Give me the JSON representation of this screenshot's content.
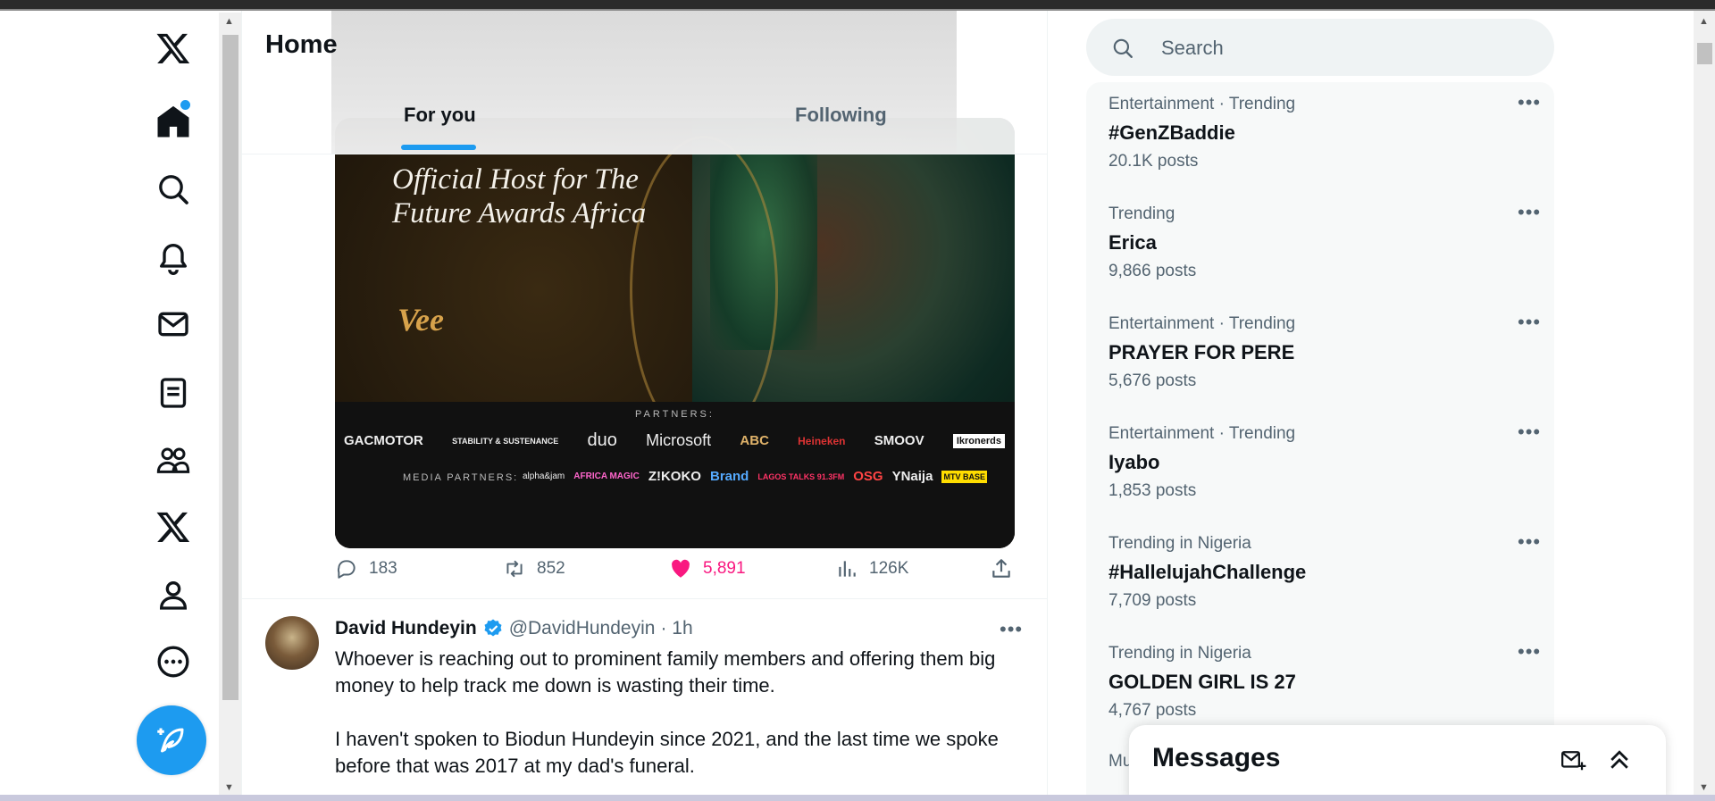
{
  "nav": {
    "items": [
      {
        "icon": "x-logo-icon"
      },
      {
        "icon": "home-icon",
        "has_notification_dot": true
      },
      {
        "icon": "search-icon"
      },
      {
        "icon": "bell-icon"
      },
      {
        "icon": "mail-icon"
      },
      {
        "icon": "lists-icon"
      },
      {
        "icon": "communities-icon"
      },
      {
        "icon": "premium-x-icon"
      },
      {
        "icon": "profile-icon"
      },
      {
        "icon": "more-circle-icon"
      }
    ],
    "compose_icon": "compose-feather-icon"
  },
  "header": {
    "title": "Home",
    "tabs": [
      {
        "label": "For you",
        "active": true
      },
      {
        "label": "Following",
        "active": false
      }
    ]
  },
  "media_card": {
    "host_text": "Official Host for The Future Awards Africa",
    "name_text": "Vee",
    "partners_label": "PARTNERS:",
    "media_partners_label": "MEDIA PARTNERS:",
    "partner_logos": [
      "GACMOTOR",
      "STABILITY & SUSTENANCE",
      "duo",
      "Microsoft",
      "ABC",
      "Heineken",
      "SMOOV",
      "Ikronerds"
    ],
    "media_partner_logos": [
      "alpha&jam",
      "AFRICA MAGIC",
      "Z!KOKO",
      "Brand",
      "LAGOS TALKS 91.3FM",
      "OSG",
      "YNaija",
      "MTV BASE"
    ]
  },
  "tweet1_actions": {
    "replies": "183",
    "retweets": "852",
    "likes": "5,891",
    "views": "126K"
  },
  "tweet2": {
    "name": "David Hundeyin",
    "handle": "@DavidHundeyin",
    "time": "· 1h",
    "more": "•••",
    "text_p1": "Whoever is reaching out to prominent family members and offering them big money to help track me down is wasting their time.",
    "text_p2": "I haven't spoken to Biodun Hundeyin since 2021, and the last time we spoke before that was 2017 at my dad's funeral."
  },
  "search": {
    "placeholder": "Search"
  },
  "trends": [
    {
      "category": "Entertainment · Trending",
      "title": "#GenZBaddie",
      "posts": "20.1K posts"
    },
    {
      "category": "Trending",
      "title": "Erica",
      "posts": "9,866 posts"
    },
    {
      "category": "Entertainment · Trending",
      "title": "PRAYER FOR PERE",
      "posts": "5,676 posts"
    },
    {
      "category": "Entertainment · Trending",
      "title": "Iyabo",
      "posts": "1,853 posts"
    },
    {
      "category": "Trending in Nigeria",
      "title": "#HallelujahChallenge",
      "posts": "7,709 posts"
    },
    {
      "category": "Trending in Nigeria",
      "title": "GOLDEN GIRL IS 27",
      "posts": "4,767 posts"
    }
  ],
  "trend_more": "•••",
  "trend_cutoff": "Mu",
  "messages": {
    "title": "Messages"
  },
  "colors": {
    "accent": "#1d9bf0",
    "like": "#f91880",
    "muted": "#536471"
  }
}
